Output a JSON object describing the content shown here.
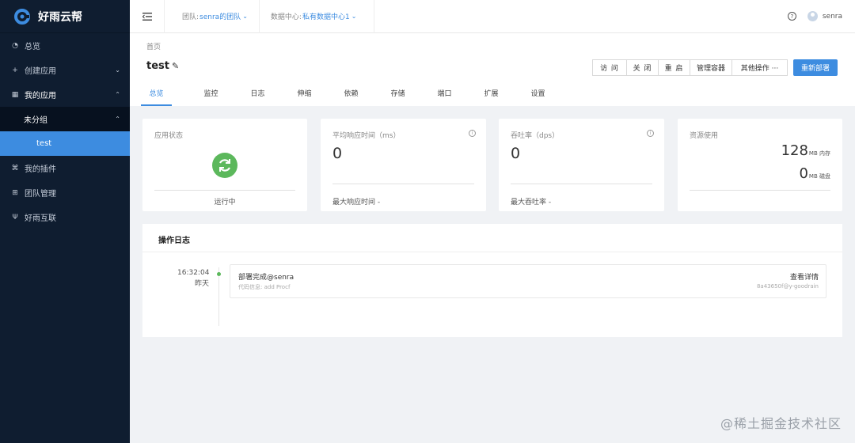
{
  "brand": {
    "name": "好雨云帮",
    "accent": "#3d8ce0"
  },
  "sidebar": {
    "items": [
      {
        "label": "总览",
        "icon": "dashboard-icon"
      },
      {
        "label": "创建应用",
        "icon": "plus-icon",
        "arrow": "chevron-down-icon"
      },
      {
        "label": "我的应用",
        "icon": "grid-icon",
        "arrow": "chevron-up-icon"
      },
      {
        "label": "未分组",
        "arrow": "chevron-up-icon"
      },
      {
        "label": "test"
      },
      {
        "label": "我的插件",
        "icon": "plugin-icon"
      },
      {
        "label": "团队管理",
        "icon": "team-icon"
      },
      {
        "label": "好雨互联",
        "icon": "link-icon"
      }
    ]
  },
  "header": {
    "team_label": "团队:",
    "team_value": "senra的团队",
    "dc_label": "数据中心:",
    "dc_value": "私有数据中心1",
    "help": "?",
    "user": "senra"
  },
  "page": {
    "breadcrumb": "首页",
    "title": "test",
    "buttons": [
      "访 问",
      "关 闭",
      "重 启",
      "管理容器",
      "其他操作 ···"
    ],
    "primary_button": "重新部署",
    "tabs": [
      "总览",
      "监控",
      "日志",
      "伸缩",
      "依赖",
      "存储",
      "端口",
      "扩展",
      "设置"
    ]
  },
  "cards": {
    "status": {
      "title": "应用状态",
      "text": "运行中",
      "color": "#5cb85c"
    },
    "response": {
      "title": "平均响应时间（ms）",
      "value": "0",
      "foot": "最大响应时间  -"
    },
    "throughput": {
      "title": "吞吐率（dps）",
      "value": "0",
      "foot": "最大吞吐率  -"
    },
    "resource": {
      "title": "资源使用",
      "mem_value": "128",
      "mem_unit": "MB 内存",
      "disk_value": "0",
      "disk_unit": "MB 磁盘"
    }
  },
  "log": {
    "title": "操作日志",
    "time": "16:32:04",
    "day": "昨天",
    "message": "部署完成@senra",
    "sub": "代码信息:  add Procf",
    "detail": "查看详情",
    "hash": "8a43650f@y-goodrain"
  },
  "watermark": "@稀土掘金技术社区"
}
